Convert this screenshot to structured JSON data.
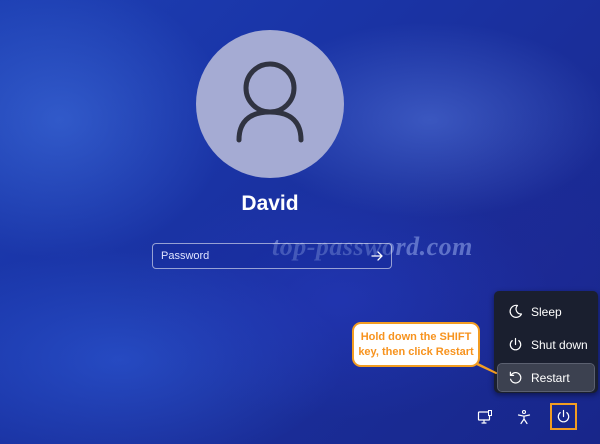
{
  "user": {
    "name": "David",
    "avatar_icon": "user-silhouette-icon"
  },
  "password": {
    "placeholder": "Password",
    "value": "",
    "submit_icon": "arrow-right-icon"
  },
  "watermark": "top-password.com",
  "power_menu": {
    "items": [
      {
        "label": "Sleep",
        "icon": "moon-icon",
        "selected": false
      },
      {
        "label": "Shut down",
        "icon": "power-icon",
        "selected": false
      },
      {
        "label": "Restart",
        "icon": "restart-icon",
        "selected": true
      }
    ]
  },
  "callout": {
    "line1": "Hold down the SHIFT",
    "line2": "key, then click Restart",
    "color": "#f29d22"
  },
  "taskbar": {
    "icons": [
      "network-icon",
      "accessibility-icon",
      "power-icon"
    ]
  },
  "colors": {
    "background": "#1a35a8",
    "avatar": "#a5abd3",
    "menu_background": "#1a1f2f",
    "accent": "#f29d22"
  }
}
